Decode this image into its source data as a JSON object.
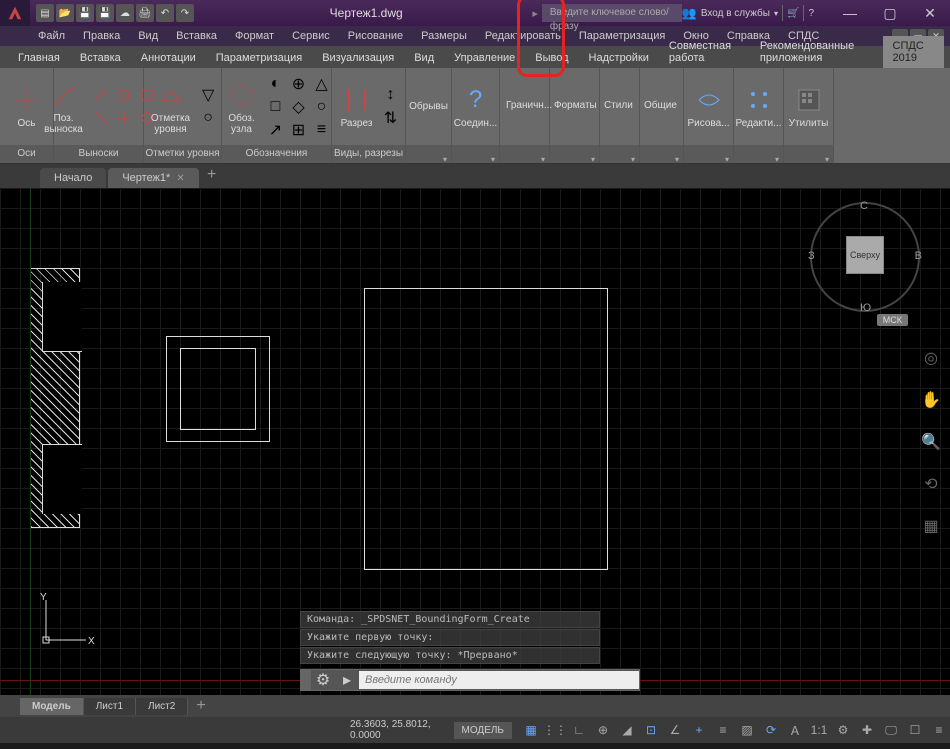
{
  "title": "Чертеж1.dwg",
  "search_placeholder": "Введите ключевое слово/фразу",
  "login_text": "Вход в службы",
  "menubar": [
    "Файл",
    "Правка",
    "Вид",
    "Вставка",
    "Формат",
    "Сервис",
    "Рисование",
    "Размеры",
    "Редактировать",
    "Параметризация",
    "Окно",
    "Справка",
    "СПДС"
  ],
  "ribbon_tabs": [
    "Главная",
    "Вставка",
    "Аннотации",
    "Параметризация",
    "Визуализация",
    "Вид",
    "Управление",
    "Вывод",
    "Надстройки",
    "Совместная работа",
    "Рекомендованные приложения"
  ],
  "ribbon_spds": "СПДС 2019",
  "panels": {
    "axes": {
      "btn": "Ось",
      "label": "Оси"
    },
    "vynoski": {
      "btn": "Поз.\nвыноска",
      "label": "Выноски"
    },
    "marks": {
      "btn": "Отметка\nуровня",
      "label": "Отметки уровня"
    },
    "oboz": {
      "btn": "Обоз.\nузла",
      "label": "Обозначения"
    },
    "razrez": {
      "btn": "Разрез",
      "label": "Виды, разрезы"
    },
    "obryvy": {
      "label": "Обрывы"
    },
    "soedin": {
      "btn": "Соедин...",
      "label": ""
    },
    "granich": {
      "label": "Граничн..."
    },
    "formaty": {
      "label": "Форматы"
    },
    "stili": {
      "label": "Стили"
    },
    "obshie": {
      "label": "Общие"
    },
    "risova": {
      "btn": "Рисова...",
      "label": ""
    },
    "redakti": {
      "btn": "Редакти...",
      "label": ""
    },
    "utility": {
      "btn": "Утилиты",
      "label": ""
    }
  },
  "filetabs": {
    "start": "Начало",
    "active": "Чертеж1*"
  },
  "viewcube": {
    "top": "Сверху",
    "n": "С",
    "s": "Ю",
    "w": "З",
    "e": "В",
    "wcs": "МСК"
  },
  "command_history": [
    "Команда: _SPDSNET_BoundingForm_Create",
    "Укажите первую точку:",
    "Укажите следующую точку: *Прервано*"
  ],
  "cmd_placeholder": "Введите команду",
  "layouts": {
    "model": "Модель",
    "l1": "Лист1",
    "l2": "Лист2"
  },
  "status": {
    "coords": "26.3603, 25.8012, 0.0000",
    "model": "МОДЕЛЬ"
  }
}
